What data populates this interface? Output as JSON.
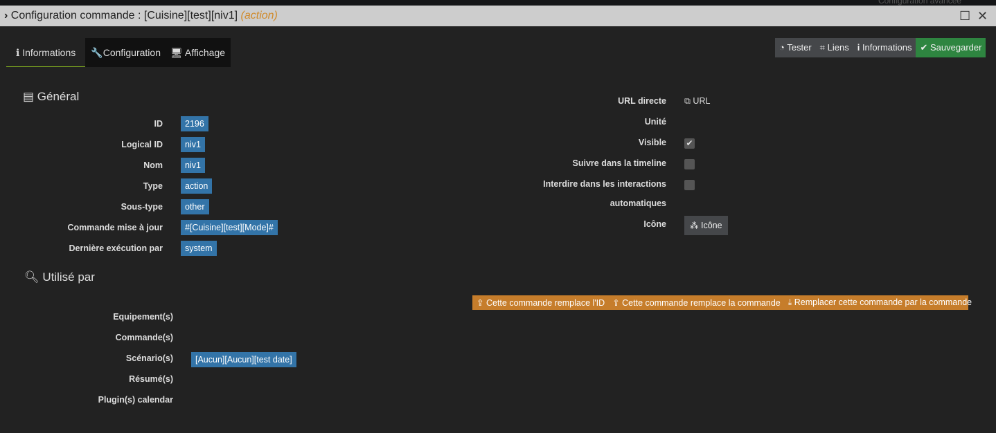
{
  "background_header": "Configuration avancée",
  "title": {
    "prefix": "Configuration commande : [Cuisine][test][niv1]",
    "type": "(action)"
  },
  "tabs": [
    {
      "label": "Informations"
    },
    {
      "label": "Configuration"
    },
    {
      "label": "Affichage"
    }
  ],
  "actions": {
    "test": "Tester",
    "links": "Liens",
    "info": "Informations",
    "save": "Sauvegarder"
  },
  "general": {
    "title": "Général",
    "fields": [
      {
        "label": "ID",
        "value": "2196"
      },
      {
        "label": "Logical ID",
        "value": "niv1"
      },
      {
        "label": "Nom",
        "value": "niv1"
      },
      {
        "label": "Type",
        "value": "action"
      },
      {
        "label": "Sous-type",
        "value": "other"
      },
      {
        "label": "Commande mise à jour",
        "value": "#[Cuisine][test][Mode]#"
      },
      {
        "label": "Dernière exécution par",
        "value": "system"
      }
    ]
  },
  "right": {
    "url_label": "URL directe",
    "url_link": "URL",
    "unite_label": "Unité",
    "visible_label": "Visible",
    "visible": true,
    "timeline_label": "Suivre dans la timeline",
    "timeline": false,
    "interdire_label": "Interdire dans les interactions",
    "interdire_label2": "automatiques",
    "interdire": false,
    "icone_label": "Icône",
    "icone_button": "Icône"
  },
  "used": {
    "title": "Utilisé par",
    "replace_buttons": [
      "Cette commande remplace l'ID",
      "Cette commande remplace la commande",
      "Remplacer cette commande par la commande"
    ],
    "rows": [
      {
        "label": "Equipement(s)"
      },
      {
        "label": "Commande(s)"
      },
      {
        "label": "Scénario(s)",
        "value": "[Aucun][Aucun][test date]"
      },
      {
        "label": "Résumé(s)"
      },
      {
        "label": "Plugin(s) calendar"
      }
    ]
  }
}
